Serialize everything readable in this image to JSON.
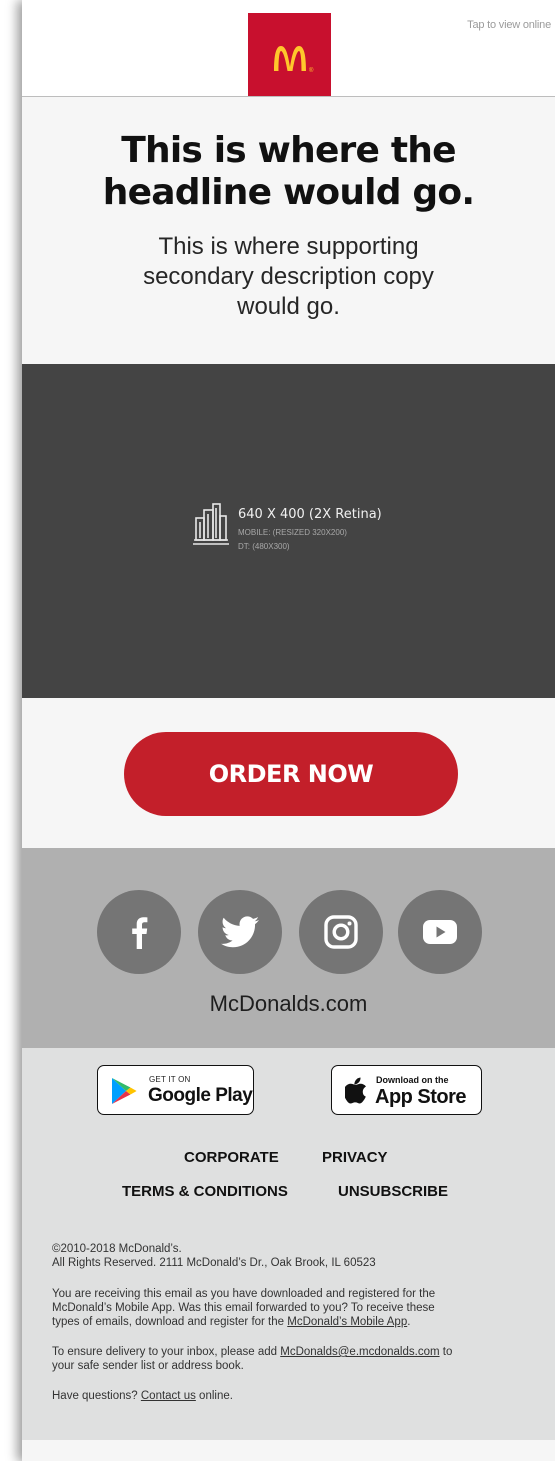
{
  "header": {
    "tap_to_view": "Tap to view online",
    "logo_mark": "M",
    "logo_registered": "®"
  },
  "hero": {
    "headline_line1": "This is where the",
    "headline_line2": "headline would go.",
    "subcopy_line1": "This is where supporting",
    "subcopy_line2": "secondary description copy",
    "subcopy_line3": "would go."
  },
  "image_placeholder": {
    "dimensions": "640 X 400 (2X Retina)",
    "mobile": "MOBILE: (RESIZED 320X200)",
    "desktop": "DT: (480X300)"
  },
  "cta": {
    "label": "ORDER NOW"
  },
  "social": {
    "icons": [
      "facebook-icon",
      "twitter-icon",
      "instagram-icon",
      "youtube-icon"
    ],
    "site_label": "McDonalds.com"
  },
  "stores": {
    "google_small": "GET IT ON",
    "google_big": "Google Play",
    "apple_small": "Download on the",
    "apple_big": "App Store"
  },
  "footer_links": {
    "corporate": "CORPORATE",
    "privacy": "PRIVACY",
    "terms": "TERMS & CONDITIONS",
    "unsubscribe": "UNSUBSCRIBE"
  },
  "legal": {
    "copyright_line1": "©2010-2018 McDonald’s.",
    "copyright_line2": "All Rights Reserved. 2111 McDonald’s Dr., Oak Brook, IL 60523",
    "reason_line1": "You are receiving this email as you have downloaded and registered for the",
    "reason_line2": "McDonald’s Mobile App. Was this email forwarded to you? To receive these",
    "reason_line3_prefix": "types of emails, download and register for the ",
    "reason_line3_link": "McDonald’s Mobile App",
    "reason_line3_suffix": ".",
    "delivery_prefix": "To ensure delivery to your inbox, please add ",
    "delivery_link": "McDonalds@e.mcdonalds.com",
    "delivery_suffix": " to",
    "delivery_line2": "your safe sender list or address book.",
    "questions_prefix": "Have questions? ",
    "questions_link": "Contact us",
    "questions_suffix": " online."
  },
  "colors": {
    "brand_red": "#c8102e",
    "brand_yellow": "#ffc72c",
    "cta_red": "#c31f2a",
    "social_band": "#b0b0b0",
    "social_circle": "#757575",
    "image_placeholder": "#444444",
    "footer_bg": "#dfe0e0"
  }
}
